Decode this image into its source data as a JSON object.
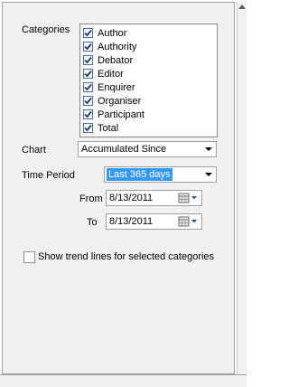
{
  "categories": {
    "label": "Categories",
    "items": [
      {
        "label": "Author",
        "checked": true
      },
      {
        "label": "Authority",
        "checked": true
      },
      {
        "label": "Debator",
        "checked": true
      },
      {
        "label": "Editor",
        "checked": true
      },
      {
        "label": "Enquirer",
        "checked": true
      },
      {
        "label": "Organiser",
        "checked": true
      },
      {
        "label": "Participant",
        "checked": true
      },
      {
        "label": "Total",
        "checked": true
      }
    ]
  },
  "chart": {
    "label": "Chart",
    "value": "Accumulated Since"
  },
  "time_period": {
    "label": "Time Period",
    "value": "Last 365 days"
  },
  "from": {
    "label": "From",
    "value": "8/13/2011"
  },
  "to": {
    "label": "To",
    "value": "8/13/2011"
  },
  "trend_lines": {
    "label": "Show trend lines for selected categories",
    "checked": false
  },
  "colors": {
    "panel_bg": "#f0f0f0",
    "selection_highlight": "#3399ff",
    "checkmark": "#1c3a70"
  }
}
